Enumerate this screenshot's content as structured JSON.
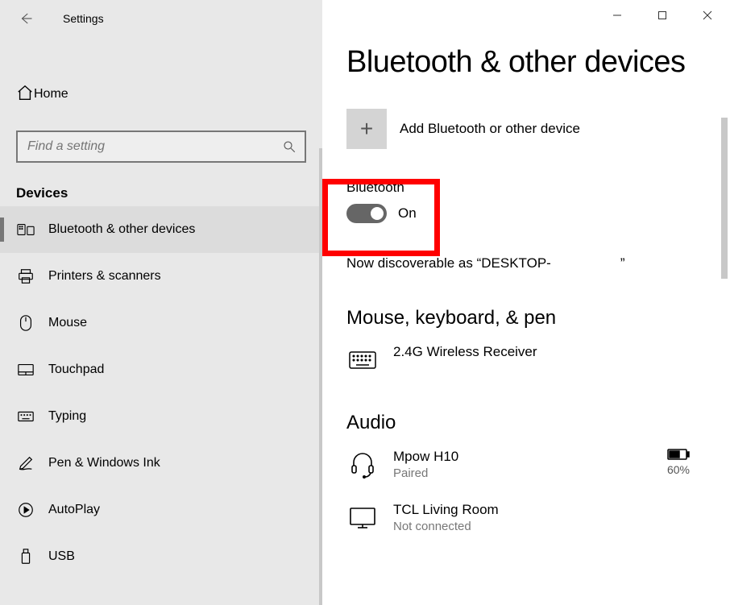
{
  "app_title": "Settings",
  "home_label": "Home",
  "search_placeholder": "Find a setting",
  "category_title": "Devices",
  "nav": [
    {
      "label": "Bluetooth & other devices"
    },
    {
      "label": "Printers & scanners"
    },
    {
      "label": "Mouse"
    },
    {
      "label": "Touchpad"
    },
    {
      "label": "Typing"
    },
    {
      "label": "Pen & Windows Ink"
    },
    {
      "label": "AutoPlay"
    },
    {
      "label": "USB"
    }
  ],
  "page_title": "Bluetooth & other devices",
  "add_device_label": "Add Bluetooth or other device",
  "bluetooth": {
    "label": "Bluetooth",
    "state": "On",
    "discoverable_prefix": "Now discoverable as “DESKTOP-",
    "discoverable_suffix": "”"
  },
  "section_mouse": "Mouse, keyboard, & pen",
  "mouse_devices": [
    {
      "name": "2.4G Wireless Receiver"
    }
  ],
  "section_audio": "Audio",
  "audio_devices": [
    {
      "name": "Mpow H10",
      "status": "Paired",
      "battery": "60%"
    },
    {
      "name": "TCL Living Room",
      "status": "Not connected"
    }
  ]
}
